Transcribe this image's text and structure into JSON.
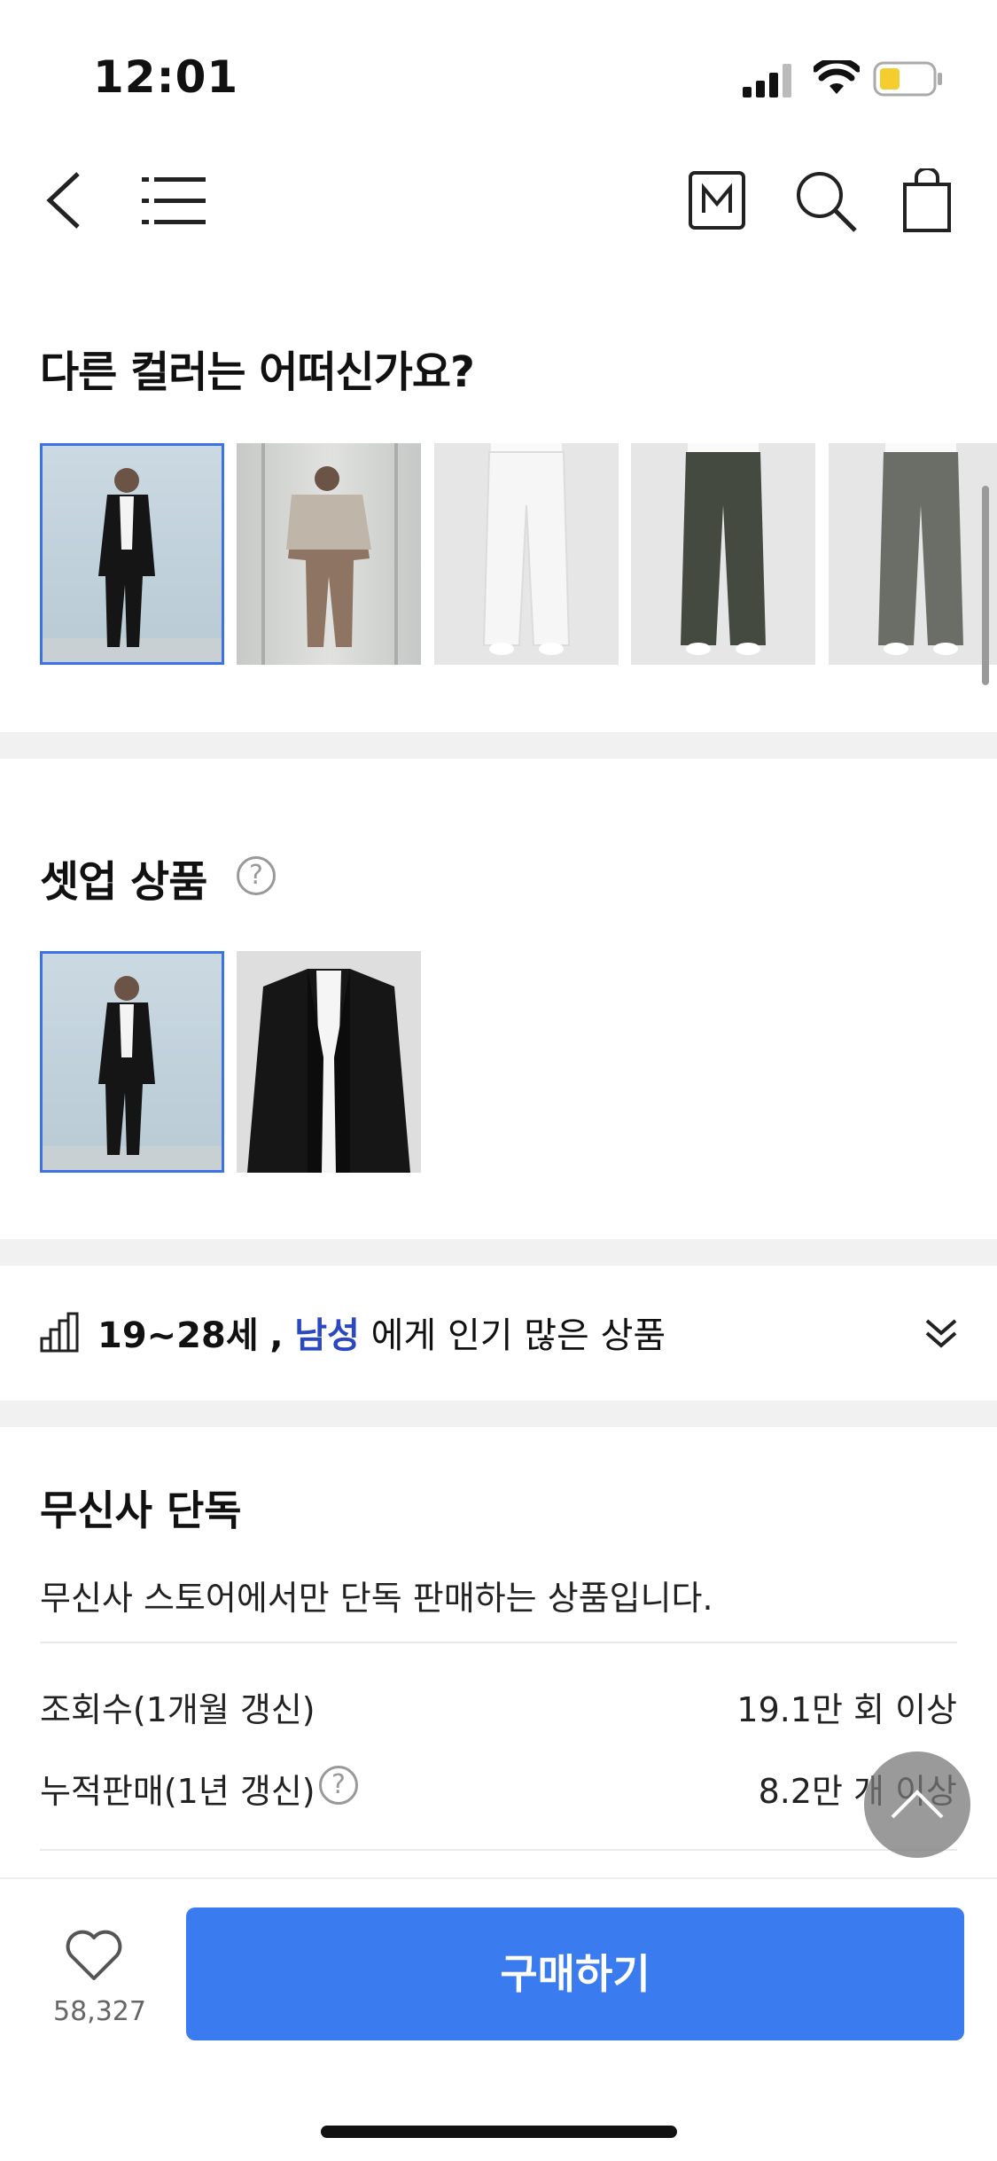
{
  "status_bar": {
    "time": "12:01"
  },
  "colors_section": {
    "title": "다른 컬러는 어떠신가요?"
  },
  "setup_section": {
    "title": "셋업 상품",
    "help_glyph": "?"
  },
  "popular": {
    "age": "19~28세",
    "comma": ",",
    "gender": "남성",
    "suffix": "에게 인기 많은 상품"
  },
  "exclusive": {
    "title": "무신사 단독",
    "description": "무신사 스토어에서만 단독 판매하는 상품입니다.",
    "views_label": "조회수(1개월 갱신)",
    "views_value": "19.1만 회 이상",
    "sales_label": "누적판매(1년 갱신)",
    "sales_value": "8.2만 개 이상"
  },
  "bottom_bar": {
    "like_count": "58,327",
    "buy_label": "구매하기"
  },
  "colors": {
    "accent": "#3a7bf0",
    "highlight_text": "#2b47c2",
    "divider": "#f1f1f1"
  }
}
